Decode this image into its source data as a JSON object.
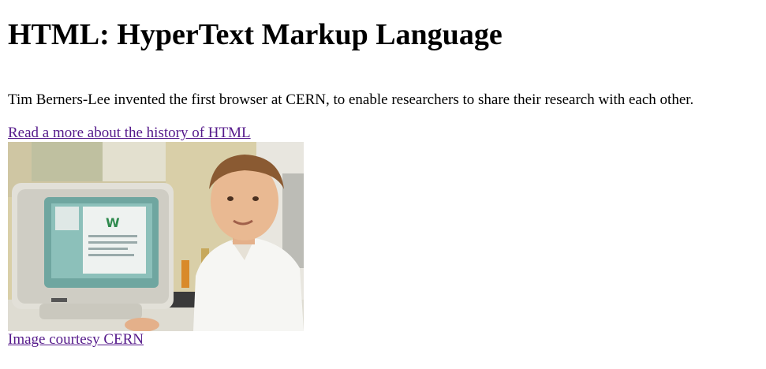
{
  "heading": "HTML: HyperText Markup Language",
  "intro": "Tim Berners-Lee invented the first browser at CERN, to enable researchers to share their research with each other.",
  "history_link": "Read a more about the history of HTML",
  "image": {
    "description": "Tim Berners-Lee sitting beside a NeXT computer monitor",
    "alt": "Tim Berners-Lee at CERN"
  },
  "credit_link": "Image courtesy CERN",
  "colors": {
    "text": "#000000",
    "visited_link": "#551a8b",
    "background": "#ffffff"
  }
}
